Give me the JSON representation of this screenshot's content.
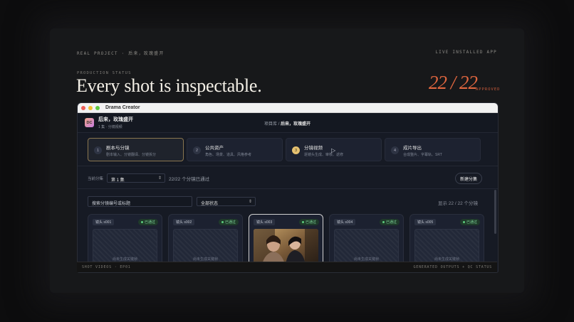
{
  "eyebrow": {
    "top_left": "REAL PROJECT · 后来，玫瑰盛开",
    "top_right": "LIVE INSTALLED APP",
    "status": "PRODUCTION STATUS"
  },
  "headline": "Every shot is inspectable.",
  "counter": {
    "value": "22 / 22",
    "label": "APPROVED"
  },
  "window": {
    "app_title": "Drama Creator",
    "logo": "DC",
    "project_name": "后来，玫瑰盛开",
    "project_sub": "1 集 · 分镜视频",
    "breadcrumb_root": "项目库",
    "breadcrumb_sep": "/",
    "breadcrumb_current": "后来，玫瑰盛开"
  },
  "steps": [
    {
      "num": "1",
      "title": "剧本与分镜",
      "sub": "剧本输入、分镜翻译、分镜拆分"
    },
    {
      "num": "2",
      "title": "公共资产",
      "sub": "角色、场景、道具、风格参考"
    },
    {
      "num": "3",
      "title": "分镜视频",
      "sub": "逐镜头生成、审核、返修"
    },
    {
      "num": "4",
      "title": "成片导出",
      "sub": "合成整片、字幕轨、SRT"
    }
  ],
  "episode": {
    "label": "当前分集",
    "selected": "第 1 集",
    "passed": "22/22 个分镜已通过",
    "new_button": "新建分集"
  },
  "filter": {
    "search_placeholder": "搜索分镜编号或标题",
    "status_selected": "全部状态",
    "showing": "显示 22 / 22 个分镜"
  },
  "cards": [
    {
      "shot": "镜头 s001",
      "status": "已通过",
      "placeholder": "尚未生成关键帧"
    },
    {
      "shot": "镜头 s002",
      "status": "已通过",
      "placeholder": "尚未生成关键帧"
    },
    {
      "shot": "镜头 s003",
      "status": "已通过",
      "placeholder": ""
    },
    {
      "shot": "镜头 s004",
      "status": "已通过",
      "placeholder": "尚未生成关键帧"
    },
    {
      "shot": "镜头 s005",
      "status": "已通过",
      "placeholder": "尚未生成关键帧"
    }
  ],
  "footer": {
    "left": "SHOT VIDEOS · EP01",
    "right": "GENERATED OUTPUTS + QC STATUS"
  },
  "colors": {
    "accent": "#e0663f",
    "step_active": "#e6c170",
    "approved": "#5ccb7d"
  },
  "icons": [
    "play-cursor-icon",
    "caret-updown-icon",
    "status-dot-icon"
  ]
}
